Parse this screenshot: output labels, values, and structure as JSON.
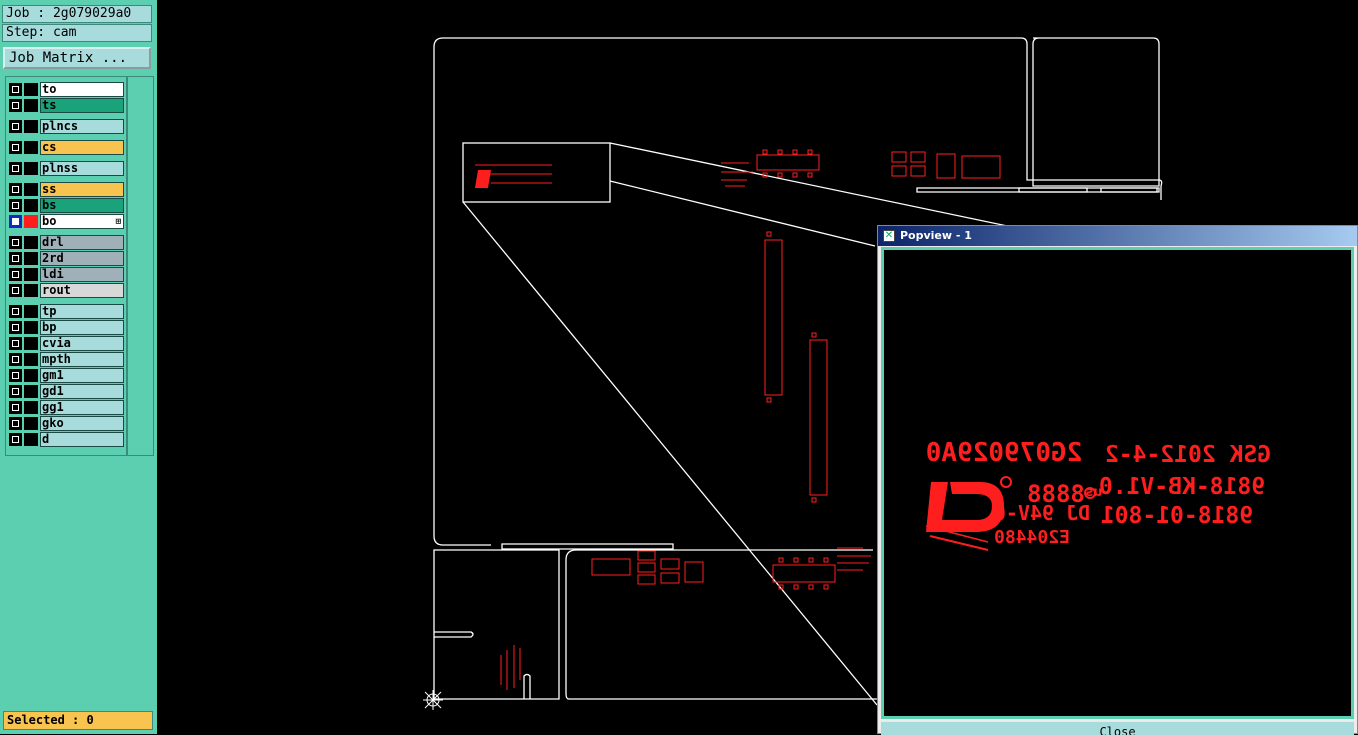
{
  "job": {
    "label": "Job : 2g079029a0",
    "step": "Step: cam"
  },
  "job_matrix_button": "Job Matrix ...",
  "layers": [
    {
      "name": "to",
      "color": "#ffffff",
      "checked": false
    },
    {
      "name": "ts",
      "color": "#1aa37a",
      "checked": false
    },
    {
      "name": "plncs",
      "color": "#a8dcdc",
      "checked": false
    },
    {
      "name": "cs",
      "color": "#f9c34f",
      "checked": false
    },
    {
      "name": "plnss",
      "color": "#a8dcdc",
      "checked": false
    },
    {
      "name": "ss",
      "color": "#f9c34f",
      "checked": false
    },
    {
      "name": "bs",
      "color": "#1aa37a",
      "checked": false
    },
    {
      "name": "bo",
      "color": "#ffffff",
      "checked": true,
      "display_color": "#ff1e1e",
      "work_mark": "⊞"
    },
    {
      "name": "drl",
      "color": "#9fb0b8",
      "checked": false
    },
    {
      "name": "2rd",
      "color": "#9fb0b8",
      "checked": false
    },
    {
      "name": "ldi",
      "color": "#9fb0b8",
      "checked": false
    },
    {
      "name": "rout",
      "color": "#d8d8d8",
      "checked": false
    },
    {
      "name": "tp",
      "color": "#a8dcdc",
      "checked": false
    },
    {
      "name": "bp",
      "color": "#a8dcdc",
      "checked": false
    },
    {
      "name": "cvia",
      "color": "#a8dcdc",
      "checked": false
    },
    {
      "name": "mpth",
      "color": "#a8dcdc",
      "checked": false
    },
    {
      "name": "gm1",
      "color": "#a8dcdc",
      "checked": false
    },
    {
      "name": "gd1",
      "color": "#a8dcdc",
      "checked": false
    },
    {
      "name": "gg1",
      "color": "#a8dcdc",
      "checked": false
    },
    {
      "name": "gko",
      "color": "#a8dcdc",
      "checked": false
    },
    {
      "name": "d",
      "color": "#a8dcdc",
      "checked": false
    }
  ],
  "status": {
    "selected": "Selected : 0"
  },
  "popview": {
    "title": "Popview - 1",
    "close_label": "Close",
    "marking_lines": [
      "2G079029A0",
      "GSK 2012-4-2",
      "9818-KB-V1.0",
      "9818-01-801",
      "DJ 94V-0",
      "E204480"
    ]
  },
  "colors": {
    "board_outline": "#ffffff",
    "silkscreen": "#ff1e1e",
    "panel": "#5ccfb0"
  }
}
